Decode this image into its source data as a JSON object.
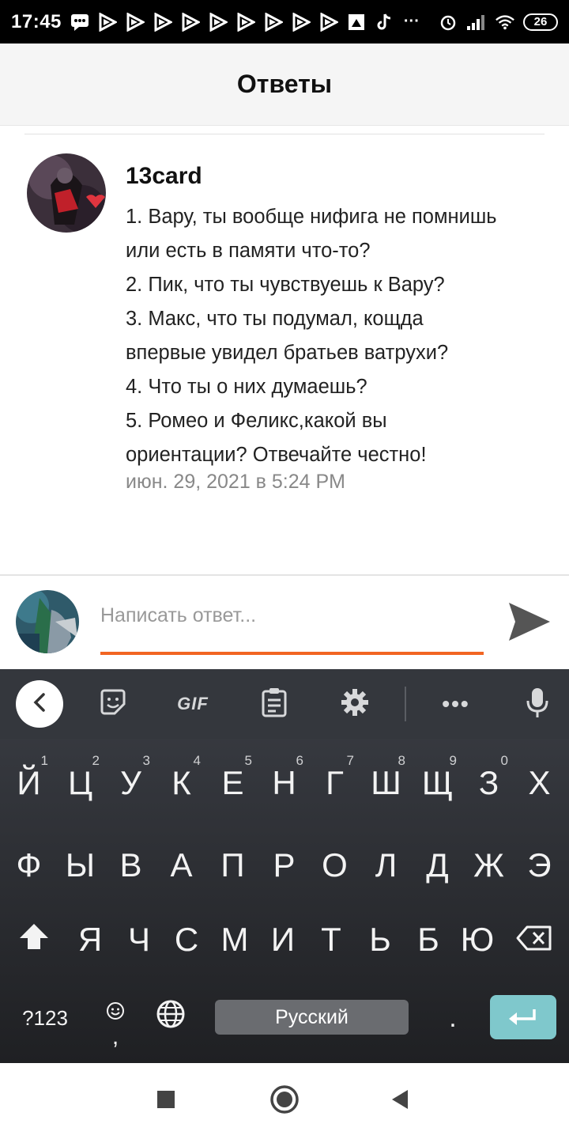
{
  "status_bar": {
    "time": "17:45",
    "battery": "26",
    "icons": [
      "message-icon",
      "play-icon",
      "play-icon",
      "play-icon",
      "play-icon",
      "play-icon",
      "play-icon",
      "play-icon",
      "play-icon",
      "play-icon",
      "image-icon",
      "tiktok-icon",
      "more-icon",
      "alarm-icon",
      "signal-icon",
      "wifi-icon"
    ]
  },
  "header": {
    "title": "Ответы"
  },
  "comment": {
    "author": "13card",
    "lines": [
      "1. Вару, ты вообще нифига не помнишь",
      "или есть в памяти что-то?",
      "2. Пик, что ты чувствуешь к Вару?",
      "3. Макс, что ты подумал, кощда",
      "впервые увидел братьев ватрухи?",
      "4. Что ты о них думаешь?",
      "5. Ромео и Феликс,какой вы",
      "ориентации? Отвечайте честно!"
    ],
    "timestamp": "июн. 29, 2021 в 5:24 PM"
  },
  "reply": {
    "placeholder": "Написать ответ...",
    "value": "",
    "accent_color": "#f26522"
  },
  "keyboard": {
    "toolbar": {
      "gif_label": "GIF",
      "more_label": "•••"
    },
    "row1": [
      {
        "label": "Й",
        "hint": "1"
      },
      {
        "label": "Ц",
        "hint": "2"
      },
      {
        "label": "У",
        "hint": "3"
      },
      {
        "label": "К",
        "hint": "4"
      },
      {
        "label": "Е",
        "hint": "5"
      },
      {
        "label": "Н",
        "hint": "6"
      },
      {
        "label": "Г",
        "hint": "7"
      },
      {
        "label": "Ш",
        "hint": "8"
      },
      {
        "label": "Щ",
        "hint": "9"
      },
      {
        "label": "З",
        "hint": "0"
      },
      {
        "label": "Х",
        "hint": ""
      }
    ],
    "row2": [
      "Ф",
      "Ы",
      "В",
      "А",
      "П",
      "Р",
      "О",
      "Л",
      "Д",
      "Ж",
      "Э"
    ],
    "row3": [
      "Я",
      "Ч",
      "С",
      "М",
      "И",
      "Т",
      "Ь",
      "Б",
      "Ю"
    ],
    "bottom": {
      "symbols": "?123",
      "comma": ",",
      "space": "Русский",
      "period": "."
    },
    "enter_color": "#7fc8cc"
  }
}
